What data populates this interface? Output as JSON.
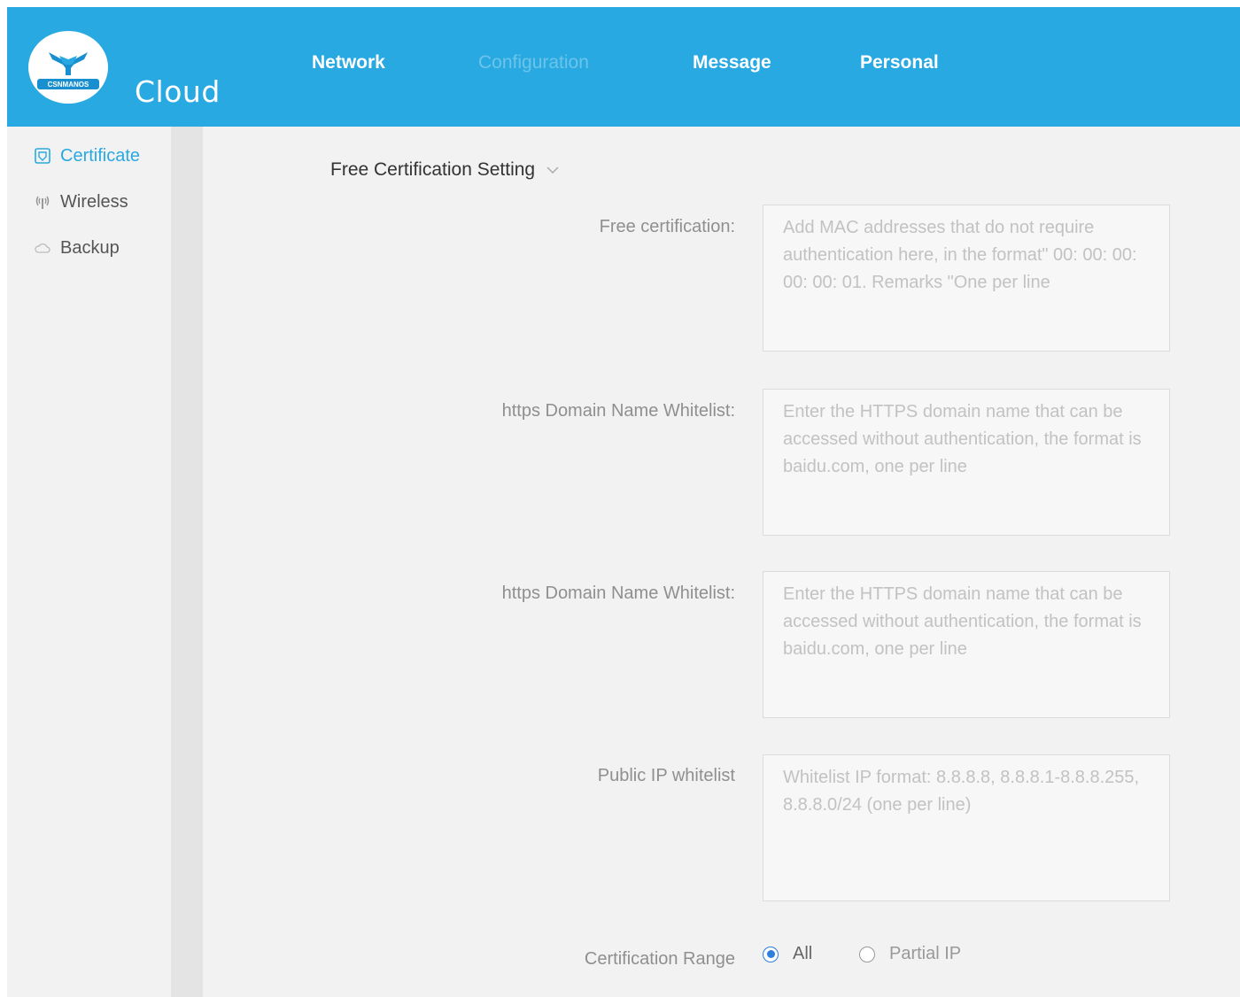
{
  "header": {
    "logo_badge_text": "CSNMANOS",
    "logo_text": "Cloud",
    "nav": [
      {
        "label": "Network",
        "active": true
      },
      {
        "label": "Configuration",
        "active": false
      },
      {
        "label": "Message",
        "active": true
      },
      {
        "label": "Personal",
        "active": true
      }
    ]
  },
  "sidebar": {
    "items": [
      {
        "label": "Certificate",
        "icon": "shield-icon",
        "active": true
      },
      {
        "label": "Wireless",
        "icon": "wireless-icon",
        "active": false
      },
      {
        "label": "Backup",
        "icon": "cloud-icon",
        "active": false
      }
    ]
  },
  "main": {
    "section_title": "Free Certification Setting",
    "fields": [
      {
        "label": "Free certification:",
        "placeholder": "Add MAC addresses that do not require authentication here, in the format\" 00: 00: 00: 00: 00: 01. Remarks \"One per line",
        "value": ""
      },
      {
        "label": "https Domain Name Whitelist:",
        "placeholder": "Enter the HTTPS domain name that can be accessed without authentication, the format is baidu.com, one per line",
        "value": ""
      },
      {
        "label": "https Domain Name Whitelist:",
        "placeholder": "Enter the HTTPS domain name that can be accessed without authentication, the format is baidu.com, one per line",
        "value": ""
      },
      {
        "label": "Public IP whitelist",
        "placeholder": "Whitelist IP format: 8.8.8.8, 8.8.8.1-8.8.8.255, 8.8.8.0/24 (one per line)",
        "value": ""
      }
    ],
    "range": {
      "label": "Certification Range",
      "options": [
        {
          "label": "All",
          "checked": true
        },
        {
          "label": "Partial IP",
          "checked": false
        }
      ]
    }
  },
  "colors": {
    "header_bg": "#29a9e1",
    "accent": "#29a9e1",
    "radio_checked": "#2f7fdc"
  }
}
